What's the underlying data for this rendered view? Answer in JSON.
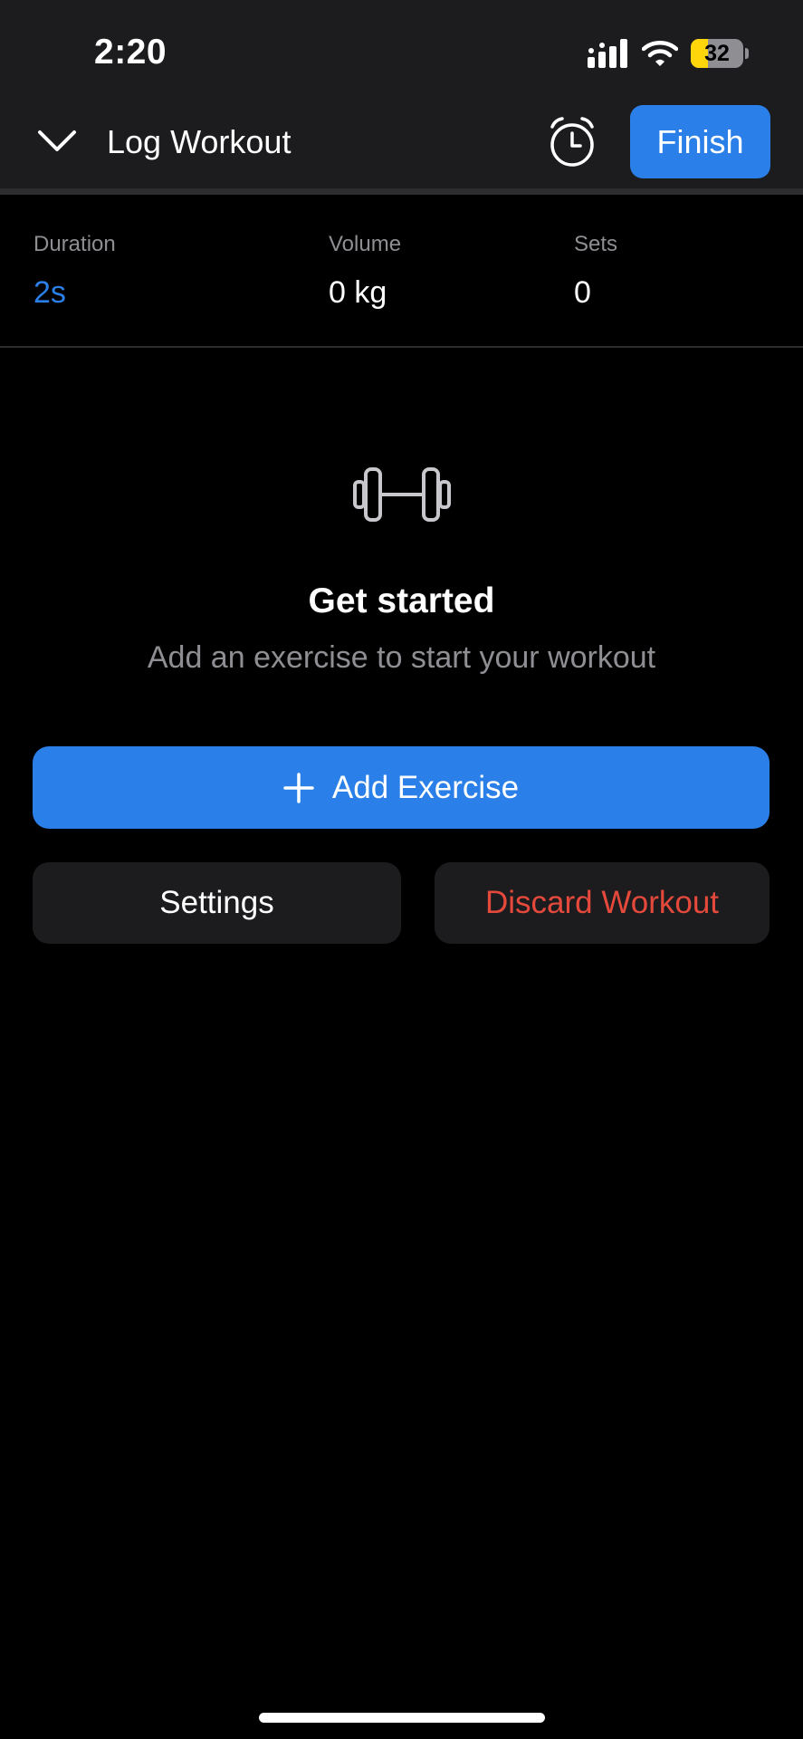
{
  "status_bar": {
    "time": "2:20",
    "battery_level": "32",
    "battery_fraction": 0.32,
    "icons": [
      "cellular-signal-icon",
      "wifi-icon",
      "battery-icon"
    ]
  },
  "header": {
    "title": "Log Workout",
    "finish_label": "Finish",
    "icons": [
      "chevron-down-icon",
      "alarm-clock-icon"
    ]
  },
  "stats": {
    "duration_label": "Duration",
    "duration_value": "2s",
    "volume_label": "Volume",
    "volume_value": "0 kg",
    "sets_label": "Sets",
    "sets_value": "0"
  },
  "empty_state": {
    "icon": "dumbbell-icon",
    "title": "Get started",
    "subtitle": "Add an exercise to start your workout"
  },
  "actions": {
    "add_exercise_label": "Add Exercise",
    "settings_label": "Settings",
    "discard_label": "Discard Workout"
  },
  "colors": {
    "accent": "#2a7fe8",
    "danger": "#e5493c",
    "background": "#000000",
    "surface": "#1c1c1e",
    "muted_text": "#8e8e93",
    "battery_fill": "#ffd60a"
  }
}
